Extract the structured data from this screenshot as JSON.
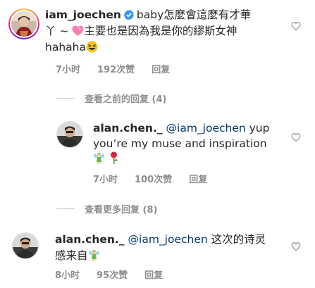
{
  "comments": [
    {
      "username": "iam_joechen",
      "verified": true,
      "line1": "baby怎麼會這麼有才華",
      "line2a": "丫 ~ ",
      "line2b": "主要也是因為我是你的繆斯女神",
      "line3": "hahaha",
      "time": "7小时",
      "likes": "192次赞",
      "reply": "回复"
    },
    {
      "username": "alan.chen._",
      "mention": "@iam_joechen",
      "line1": " yup",
      "line2": "you’re my muse and inspiration",
      "time": "7小时",
      "likes": "100次赞",
      "reply": "回复"
    },
    {
      "username": "alan.chen._",
      "mention": "@iam_joechen",
      "line1": " 这次的诗灵",
      "line2": "感来自",
      "time": "8小时",
      "likes": "95次赞",
      "reply": "回复"
    }
  ],
  "view_previous": "查看之前的回复 (4)",
  "view_more": "查看更多回复 (8)",
  "icons": [
    "verified-badge-icon",
    "heart-emoji-icon",
    "grinning-emoji-icon",
    "fairy-emoji-icon",
    "rose-emoji-icon",
    "like-heart-icon"
  ],
  "colors": {
    "mention": "#00376b",
    "meta": "#8e8e8e",
    "verified": "#3897f0"
  }
}
